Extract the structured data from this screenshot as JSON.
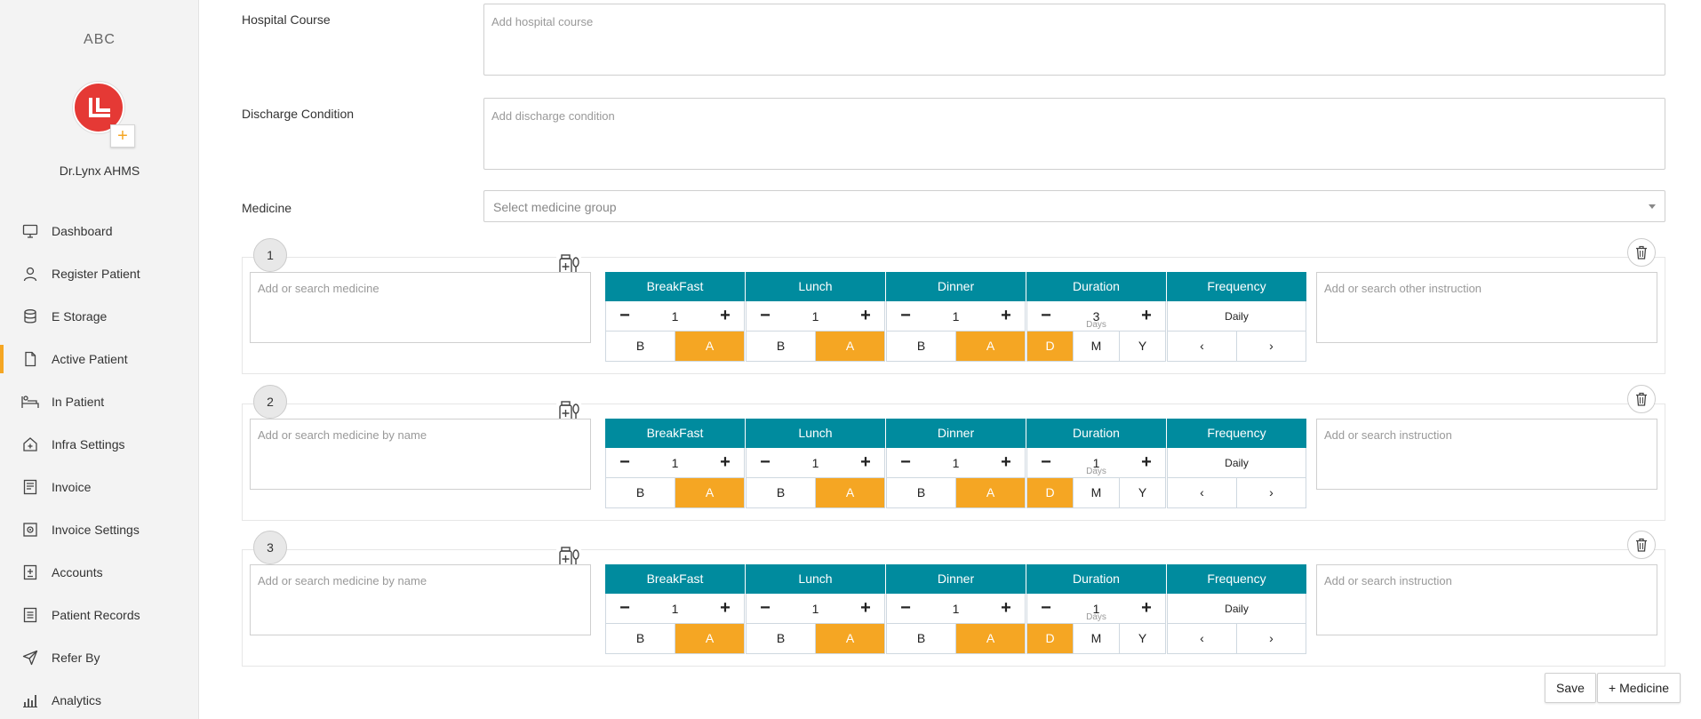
{
  "sidebar": {
    "brand": "ABC",
    "user_name": "Dr.Lynx AHMS",
    "avatar_add": "+",
    "items": [
      {
        "label": "Dashboard",
        "icon": "monitor-icon"
      },
      {
        "label": "Register Patient",
        "icon": "user-icon"
      },
      {
        "label": "E Storage",
        "icon": "database-icon"
      },
      {
        "label": "Active Patient",
        "icon": "file-icon",
        "active": true
      },
      {
        "label": "In Patient",
        "icon": "bed-icon"
      },
      {
        "label": "Infra Settings",
        "icon": "home-plus-icon"
      },
      {
        "label": "Invoice",
        "icon": "invoice-icon"
      },
      {
        "label": "Invoice Settings",
        "icon": "invoice-settings-icon"
      },
      {
        "label": "Accounts",
        "icon": "accounts-icon"
      },
      {
        "label": "Patient Records",
        "icon": "records-icon"
      },
      {
        "label": "Refer By",
        "icon": "send-icon"
      },
      {
        "label": "Analytics",
        "icon": "bar-chart-icon"
      }
    ],
    "accent": "#f5a623"
  },
  "form": {
    "hospital_course_label": "Hospital Course",
    "hospital_course_placeholder": "Add hospital course",
    "discharge_label": "Discharge Condition",
    "discharge_placeholder": "Add discharge condition",
    "medicine_label": "Medicine",
    "medicine_select_placeholder": "Select medicine group"
  },
  "dose_headers": {
    "breakfast": "BreakFast",
    "lunch": "Lunch",
    "dinner": "Dinner",
    "duration": "Duration",
    "frequency": "Frequency"
  },
  "dose_labels": {
    "minus": "−",
    "plus": "+",
    "before": "B",
    "after": "A",
    "day": "D",
    "month": "M",
    "year": "Y",
    "prev": "‹",
    "next": "›",
    "days": "Days"
  },
  "medicines": [
    {
      "num": "1",
      "placeholder": "Add or search medicine",
      "instruction_placeholder": "Add or search other instruction",
      "breakfast": "1",
      "lunch": "1",
      "dinner": "1",
      "duration": "3",
      "frequency": "Daily"
    },
    {
      "num": "2",
      "placeholder": "Add or search medicine by name",
      "instruction_placeholder": "Add or search instruction",
      "breakfast": "1",
      "lunch": "1",
      "dinner": "1",
      "duration": "1",
      "frequency": "Daily"
    },
    {
      "num": "3",
      "placeholder": "Add or search medicine by name",
      "instruction_placeholder": "Add or search instruction",
      "breakfast": "1",
      "lunch": "1",
      "dinner": "1",
      "duration": "1",
      "frequency": "Daily"
    }
  ],
  "actions": {
    "save": "Save",
    "add_medicine": "+ Medicine"
  },
  "colors": {
    "header_teal": "#008b9e",
    "toggle_on": "#f5a623",
    "avatar_red": "#e53935"
  }
}
